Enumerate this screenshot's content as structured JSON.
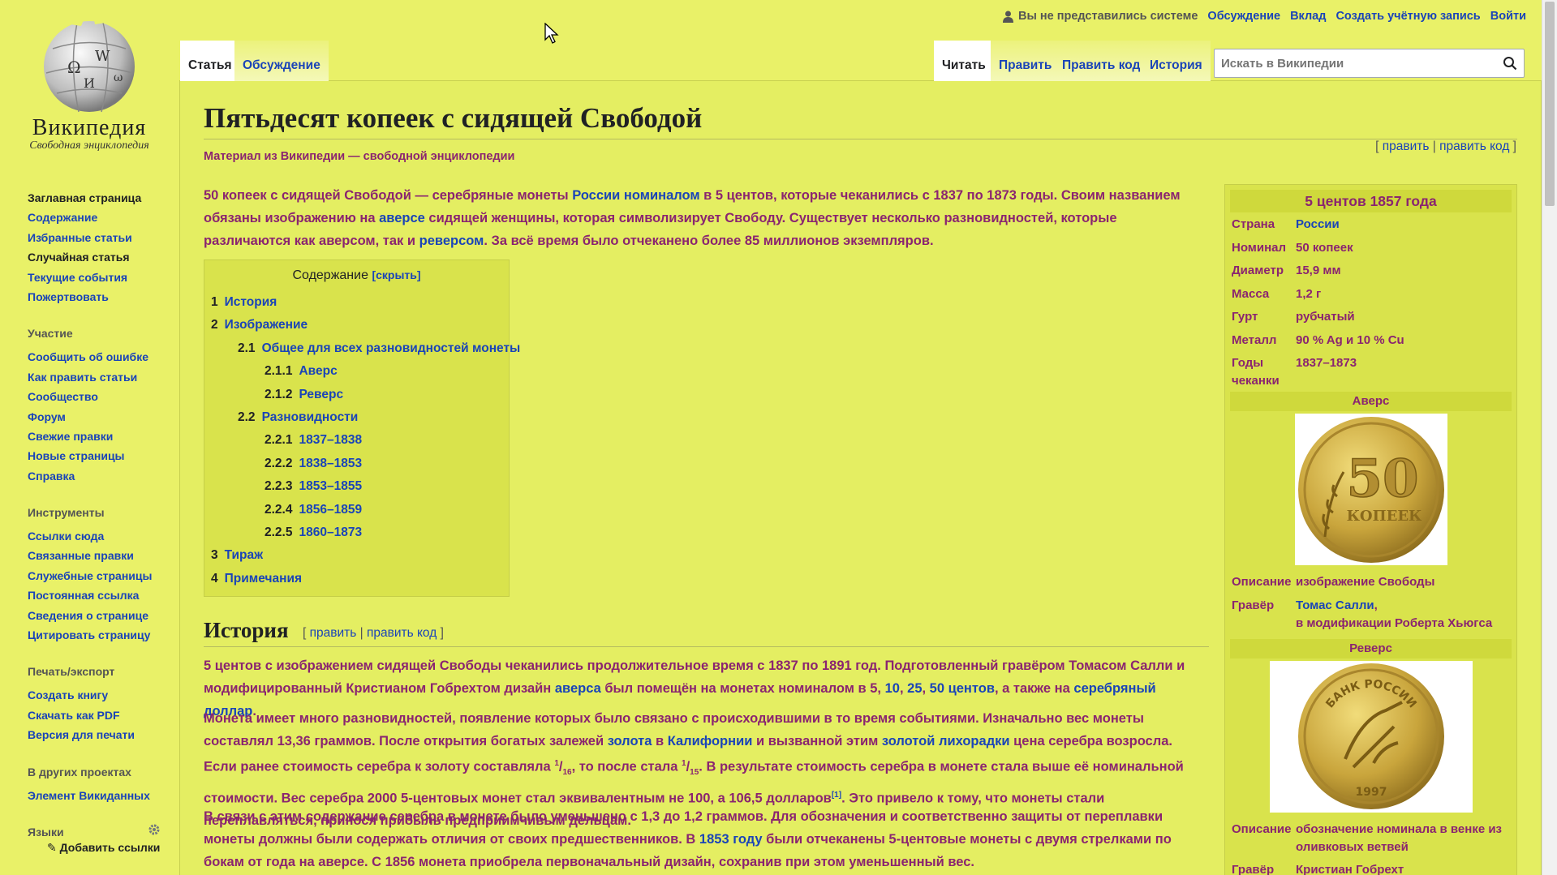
{
  "logo": {
    "wordmark": "Википедия",
    "tagline": "Свободная энциклопедия"
  },
  "personal": {
    "anon": "Вы не представились системе",
    "links": [
      "Обсуждение",
      "Вклад",
      "Создать учётную запись",
      "Войти"
    ]
  },
  "tabs": {
    "article": "Статья",
    "talk": "Обсуждение",
    "read": "Читать",
    "edit": "Править",
    "edit_source": "Править код",
    "history": "История"
  },
  "search": {
    "placeholder": "Искать в Википедии"
  },
  "sidebar": {
    "nav": [
      "Заглавная страница",
      "Содержание",
      "Избранные статьи",
      "Случайная статья",
      "Текущие события",
      "Пожертвовать"
    ],
    "participation": {
      "heading": "Участие",
      "items": [
        "Сообщить об ошибке",
        "Как править статьи",
        "Сообщество",
        "Форум",
        "Свежие правки",
        "Новые страницы",
        "Справка"
      ]
    },
    "tools": {
      "heading": "Инструменты",
      "items": [
        "Ссылки сюда",
        "Связанные правки",
        "Служебные страницы",
        "Постоянная ссылка",
        "Сведения о странице",
        "Цитировать страницу"
      ]
    },
    "print": {
      "heading": "Печать/экспорт",
      "items": [
        "Создать книгу",
        "Скачать как PDF",
        "Версия для печати"
      ]
    },
    "projects": {
      "heading": "В других проектах",
      "items": [
        "Элемент Викиданных"
      ]
    },
    "languages": {
      "heading": "Языки",
      "add_links": "Добавить ссылки"
    }
  },
  "article": {
    "title": "Пятьдесят копеек с сидящей Свободой",
    "site_sub": "Материал из Википедии — свободной энциклопедии",
    "edit_top": {
      "open": "[ ",
      "edit": "править",
      "sep": " | ",
      "edit_source": "править код",
      "close": " ]"
    },
    "lead": {
      "b1": "50 копеек с сидящей Свободой",
      "t1": " — серебряные монеты ",
      "l1": "России",
      "t2": " ",
      "l2": "номиналом",
      "t3": " в 5 центов, которые чеканились с 1837 по 1873 годы. Своим названием обязаны изображению на ",
      "l3": "аверсе",
      "t4": " сидящей женщины, которая символизирует Свободу. Существует несколько разновидностей, которые различаются как аверсом, так и ",
      "l4": "реверсом",
      "t5": ". За всё время было отчеканено более 85 миллионов экземпляров."
    },
    "toc": {
      "title": "Содержание",
      "hide": "[скрыть]",
      "items": [
        {
          "num": "1",
          "label": "История"
        },
        {
          "num": "2",
          "label": "Изображение"
        },
        {
          "num": "2.1",
          "label": "Общее для всех разновидностей монеты"
        },
        {
          "num": "2.1.1",
          "label": "Аверс"
        },
        {
          "num": "2.1.2",
          "label": "Реверс"
        },
        {
          "num": "2.2",
          "label": "Разновидности"
        },
        {
          "num": "2.2.1",
          "label": "1837–1838"
        },
        {
          "num": "2.2.2",
          "label": "1838–1853"
        },
        {
          "num": "2.2.3",
          "label": "1853–1855"
        },
        {
          "num": "2.2.4",
          "label": "1856–1859"
        },
        {
          "num": "2.2.5",
          "label": "1860–1873"
        },
        {
          "num": "3",
          "label": "Тираж"
        },
        {
          "num": "4",
          "label": "Примечания"
        }
      ]
    },
    "history": {
      "heading": "История",
      "edit": {
        "open": "[ ",
        "edit": "править",
        "sep": " | ",
        "edit_source": "править код",
        "close": " ]"
      },
      "p1": {
        "t1": "5 центов с изображением сидящей Свободы чеканились продолжительное время с 1837 по 1891 год. Подготовленный гравёром Томасом Салли и модифицированный Кристианом Гобрехтом дизайн ",
        "l1": "аверса",
        "t2": " был помещён на монетах номиналом в 5, ",
        "l2": "10",
        "t3": ", ",
        "l3": "25",
        "t4": ", ",
        "l4": "50 центов",
        "t5": ", а также на ",
        "l5": "серебряный доллар",
        "t6": "."
      },
      "p2": {
        "t1": "Монета имеет много разновидностей, появление которых было связано с происходившими в то время событиями. Изначально вес монеты составлял 13,36 граммов. После открытия богатых залежей ",
        "l1": "золота",
        "t2": " в ",
        "l2": "Калифорнии",
        "t3": " и вызванной этим ",
        "l3": "золотой лихорадки",
        "t4": " цена серебра возросла. Если ранее стоимость серебра к золоту составляла ",
        "f1_num": "1",
        "f1_den": "16",
        "t5": ", то после стала ",
        "f2_num": "1",
        "f2_den": "15",
        "t6": ". В результате стоимость серебра в монете стала выше её номинальной стоимости. Вес серебра 2000 5-центовых монет стал эквивалентным не 100, а 106,5 долларов",
        "ref": "[1]",
        "t7": ". Это привело к тому, что монеты стали переплавляться, принося прибыль предприимчивым дельцам."
      },
      "p3": {
        "t1": "В связи с этим содержание серебра в монете было уменьшено с 1,3 до 1,2 граммов. Для обозначения и соответственно защиты от переплавки монеты должны были содержать отличия от своих предшественников. В ",
        "l1": "1853 году",
        "t2": " были отчеканены 5-центовые монеты с двумя стрелками по бокам от года на аверсе. С 1856 монета приобрела первоначальный дизайн, сохранив при этом уменьшенный вес."
      }
    }
  },
  "infobox": {
    "caption": "5 центов 1857 года",
    "rows": [
      {
        "k": "Страна",
        "v": "России",
        "link": true
      },
      {
        "k": "Номинал",
        "v": "50 копеек"
      },
      {
        "k": "Диаметр",
        "v": "15,9 мм"
      },
      {
        "k": "Масса",
        "v": "1,2 г"
      },
      {
        "k": "Гурт",
        "v": "рубчатый"
      },
      {
        "k": "Металл",
        "v": "90 % Ag и 10 % Cu"
      },
      {
        "k": "Годы чеканки",
        "v": "1837–1873"
      }
    ],
    "obverse": {
      "heading": "Аверс",
      "coin_number": "50",
      "coin_word": "КОПЕЕК",
      "desc_k": "Описание",
      "desc_v": "изображение Свободы",
      "engr_k": "Гравёр",
      "engr_v1": "Томас Салли",
      "engr_v1_tail": ",",
      "engr_v2": "в модификации Роберта Хьюгса"
    },
    "reverse": {
      "heading": "Реверс",
      "coin_rim": "БАНК РОССИИ",
      "coin_year": "1997",
      "desc_k": "Описание",
      "desc_v": "обозначение номинала в венке из оливковых ветвей",
      "engr_k": "Гравёр",
      "engr_v": "Кристиан Гобрехт"
    }
  },
  "colors": {
    "page_bg": "#e9f168",
    "link": "#1a44b8",
    "text": "#8a2470"
  }
}
